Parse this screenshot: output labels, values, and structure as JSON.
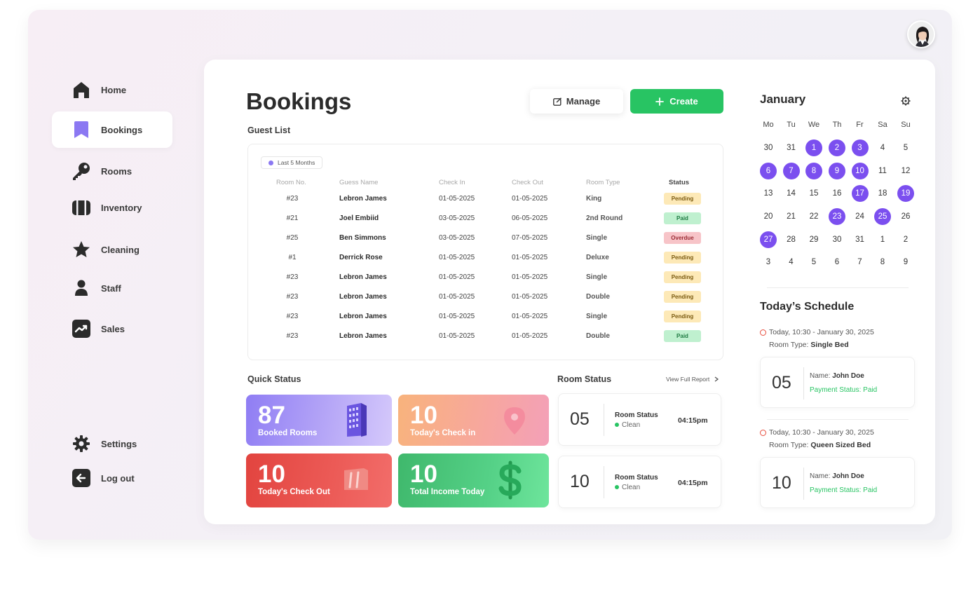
{
  "nav": {
    "items": [
      {
        "label": "Home",
        "icon": "home-icon"
      },
      {
        "label": "Bookings",
        "icon": "bookmark-icon"
      },
      {
        "label": "Rooms",
        "icon": "key-icon"
      },
      {
        "label": "Inventory",
        "icon": "luggage-icon"
      },
      {
        "label": "Cleaning",
        "icon": "star-icon"
      },
      {
        "label": "Staff",
        "icon": "person-icon"
      },
      {
        "label": "Sales",
        "icon": "trend-icon"
      }
    ],
    "bottom": [
      {
        "label": "Settings",
        "icon": "gear-icon"
      },
      {
        "label": "Log out",
        "icon": "logout-icon"
      }
    ]
  },
  "header": {
    "title": "Bookings",
    "manage_label": "Manage",
    "create_label": "Create"
  },
  "guest_list": {
    "label": "Guest List",
    "filter": "Last 5 Months",
    "columns": [
      "Room No.",
      "Guess Name",
      "Check In",
      "Check Out",
      "Room Type",
      "Status"
    ],
    "rows": [
      {
        "room": "#23",
        "name": "Lebron James",
        "check_in": "01-05-2025",
        "check_out": "01-05-2025",
        "type": "King",
        "status": "Pending"
      },
      {
        "room": "#21",
        "name": "Joel Embiid",
        "check_in": "03-05-2025",
        "check_out": "06-05-2025",
        "type": "2nd Round",
        "status": "Paid"
      },
      {
        "room": "#25",
        "name": "Ben Simmons",
        "check_in": "03-05-2025",
        "check_out": "07-05-2025",
        "type": "Single",
        "status": "Overdue"
      },
      {
        "room": "#1",
        "name": "Derrick Rose",
        "check_in": "01-05-2025",
        "check_out": "01-05-2025",
        "type": "Deluxe",
        "status": "Pending"
      },
      {
        "room": "#23",
        "name": "Lebron James",
        "check_in": "01-05-2025",
        "check_out": "01-05-2025",
        "type": "Single",
        "status": "Pending"
      },
      {
        "room": "#23",
        "name": "Lebron James",
        "check_in": "01-05-2025",
        "check_out": "01-05-2025",
        "type": "Double",
        "status": "Pending"
      },
      {
        "room": "#23",
        "name": "Lebron James",
        "check_in": "01-05-2025",
        "check_out": "01-05-2025",
        "type": "Single",
        "status": "Pending"
      },
      {
        "room": "#23",
        "name": "Lebron James",
        "check_in": "01-05-2025",
        "check_out": "01-05-2025",
        "type": "Double",
        "status": "Paid"
      }
    ]
  },
  "status_colors": {
    "Pending": {
      "bg": "#fde9b7",
      "fg": "#7a5a10"
    },
    "Paid": {
      "bg": "#bff0cf",
      "fg": "#1f7a42"
    },
    "Overdue": {
      "bg": "#f7c4c8",
      "fg": "#9b2c34"
    }
  },
  "quick_status": {
    "label": "Quick Status",
    "tiles": [
      {
        "number": "87",
        "label": "Booked Rooms"
      },
      {
        "number": "10",
        "label": "Today's Check in"
      },
      {
        "number": "10",
        "label": "Today's Check Out"
      },
      {
        "number": "10",
        "label": "Total Income Today"
      }
    ]
  },
  "room_status": {
    "label": "Room Status",
    "report_link": "View Full Report",
    "cards": [
      {
        "number": "05",
        "title": "Room Status",
        "state": "Clean",
        "time": "04:15pm"
      },
      {
        "number": "10",
        "title": "Room Status",
        "state": "Clean",
        "time": "04:15pm"
      }
    ]
  },
  "calendar": {
    "month": "January",
    "weekdays": [
      "Mo",
      "Tu",
      "We",
      "Th",
      "Fr",
      "Sa",
      "Su"
    ],
    "weeks": [
      [
        30,
        31,
        1,
        2,
        3,
        4,
        5
      ],
      [
        6,
        7,
        8,
        9,
        10,
        11,
        12
      ],
      [
        13,
        14,
        15,
        16,
        17,
        18,
        19
      ],
      [
        20,
        21,
        22,
        23,
        24,
        25,
        26
      ],
      [
        27,
        28,
        29,
        30,
        31,
        1,
        2
      ],
      [
        3,
        4,
        5,
        6,
        7,
        8,
        9
      ]
    ],
    "highlighted": [
      [
        0,
        2
      ],
      [
        0,
        3
      ],
      [
        0,
        4
      ],
      [
        1,
        0
      ],
      [
        1,
        1
      ],
      [
        1,
        2
      ],
      [
        1,
        3
      ],
      [
        1,
        4
      ],
      [
        2,
        4
      ],
      [
        2,
        6
      ],
      [
        3,
        3
      ],
      [
        3,
        5
      ],
      [
        4,
        0
      ]
    ],
    "accent": "#7b4fef"
  },
  "schedule": {
    "title": "Today’s Schedule",
    "items": [
      {
        "when": "Today, 10:30 - January 30, 2025",
        "room_type_label": "Room Type:",
        "room_type": "Single Bed",
        "number": "05",
        "name_label": "Name:",
        "name": "John Doe",
        "payment_label": "Payment Status:",
        "payment": "Paid"
      },
      {
        "when": "Today, 10:30 - January 30, 2025",
        "room_type_label": "Room Type:",
        "room_type": "Queen Sized Bed",
        "number": "10",
        "name_label": "Name:",
        "name": "John Doe",
        "payment_label": "Payment Status:",
        "payment": "Paid"
      }
    ]
  }
}
